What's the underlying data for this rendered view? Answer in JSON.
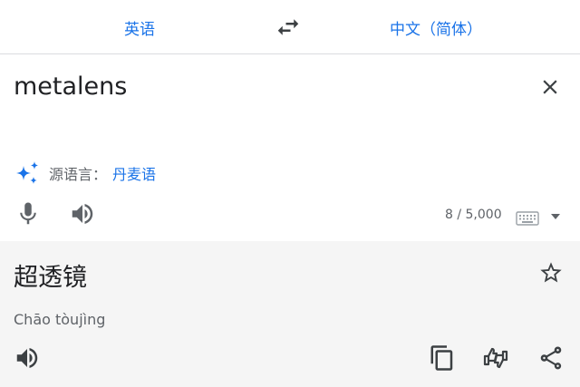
{
  "language_bar": {
    "source_language": "英语",
    "target_language": "中文（简体）"
  },
  "input": {
    "text": "metalens"
  },
  "detection": {
    "prefix": "源语言：",
    "language": "丹麦语"
  },
  "char_counter": "8 / 5,000",
  "result": {
    "text": "超透镜",
    "transliteration": "Chāo tòujìng"
  },
  "colors": {
    "accent": "#1a73e8",
    "icon": "#5f6368",
    "result_background": "#f5f5f5"
  },
  "icons": {
    "swap": "swap-arrows-icon",
    "clear": "close-icon",
    "detect": "sparkle-icon",
    "mic": "microphone-icon",
    "speaker": "speaker-icon",
    "keyboard": "keyboard-icon",
    "keyboard_menu": "triangle-down-icon",
    "star": "star-outline-icon",
    "copy": "copy-icon",
    "feedback": "feedback-icon",
    "share": "share-icon"
  }
}
